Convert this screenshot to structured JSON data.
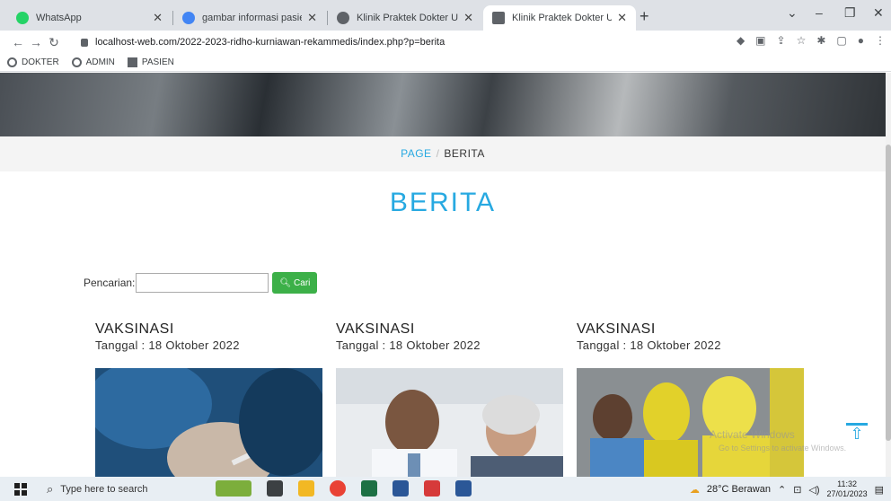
{
  "browser": {
    "tabs": [
      {
        "title": "WhatsApp",
        "icon": "whatsapp-icon",
        "icon_color": "#25d366"
      },
      {
        "title": "gambar informasi pasien - Goog",
        "icon": "google-icon",
        "icon_color": "#4285f4"
      },
      {
        "title": "Klinik Praktek Dokter Umum Dr.R",
        "icon": "globe-icon",
        "icon_color": "#5f6368"
      },
      {
        "title": "Klinik Praktek Dokter Umum Dr.R",
        "icon": "page-icon",
        "icon_color": "#5f6368"
      }
    ],
    "url": "localhost-web.com/2022-2023-ridho-kurniawan-rekammedis/index.php?p=berita",
    "bookmarks": [
      {
        "label": "DOKTER",
        "icon": "globe-icon"
      },
      {
        "label": "ADMIN",
        "icon": "globe-icon"
      },
      {
        "label": "PASIEN",
        "icon": "image-icon"
      }
    ]
  },
  "page": {
    "breadcrumb": {
      "link": "PAGE",
      "separator": "/",
      "current": "BERITA"
    },
    "heading": "BERITA",
    "search": {
      "label": "Pencarian:",
      "value": "",
      "button": "Cari"
    },
    "news": [
      {
        "title": "VAKSINASI",
        "date": "Tanggal : 18 Oktober 2022"
      },
      {
        "title": "VAKSINASI",
        "date": "Tanggal : 18 Oktober 2022"
      },
      {
        "title": "VAKSINASI",
        "date": "Tanggal : 18 Oktober 2022"
      }
    ],
    "watermark": {
      "line1": "Activate Windows",
      "line2": "Go to Settings to activate Windows."
    }
  },
  "taskbar": {
    "search_placeholder": "Type here to search",
    "weather": "28°C  Berawan",
    "time": "11:32",
    "date": "27/01/2023"
  },
  "colors": {
    "accent": "#27a9e1",
    "button_green": "#3cb048"
  }
}
